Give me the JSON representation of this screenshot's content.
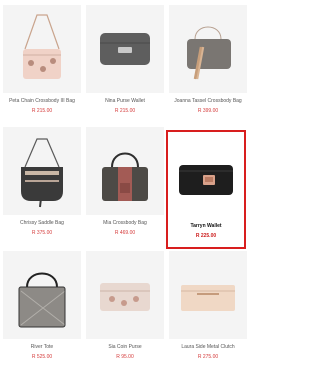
{
  "products": [
    {
      "name": "Peta Chain Crossbody III Bag",
      "price": "R 215.00",
      "icon": "crossbody-bag-icon",
      "selected": false
    },
    {
      "name": "Nina Purse Wallet",
      "price": "R 215.00",
      "icon": "wallet-icon",
      "selected": false
    },
    {
      "name": "Joanna Tassel Crossbody Bag",
      "price": "R 399.00",
      "icon": "tassel-bag-icon",
      "selected": false
    },
    {
      "name": "Chrissy Saddle Bag",
      "price": "R 375.00",
      "icon": "saddle-bag-icon",
      "selected": false
    },
    {
      "name": "Mia Crossbody Bag",
      "price": "R 469.00",
      "icon": "crossbody-bag-icon",
      "selected": false
    },
    {
      "name": "Tarryn Wallet",
      "price": "R 225.00",
      "icon": "wallet-icon",
      "selected": true
    },
    {
      "name": "River Tote",
      "price": "R 525.00",
      "icon": "tote-bag-icon",
      "selected": false
    },
    {
      "name": "Sia Coin Purse",
      "price": "R 95.00",
      "icon": "coin-purse-icon",
      "selected": false
    },
    {
      "name": "Laura Side Metal Clutch",
      "price": "R 275.00",
      "icon": "clutch-icon",
      "selected": false
    }
  ],
  "colors": {
    "price": "#d53b3b",
    "selected_border": "#d81e1e"
  }
}
